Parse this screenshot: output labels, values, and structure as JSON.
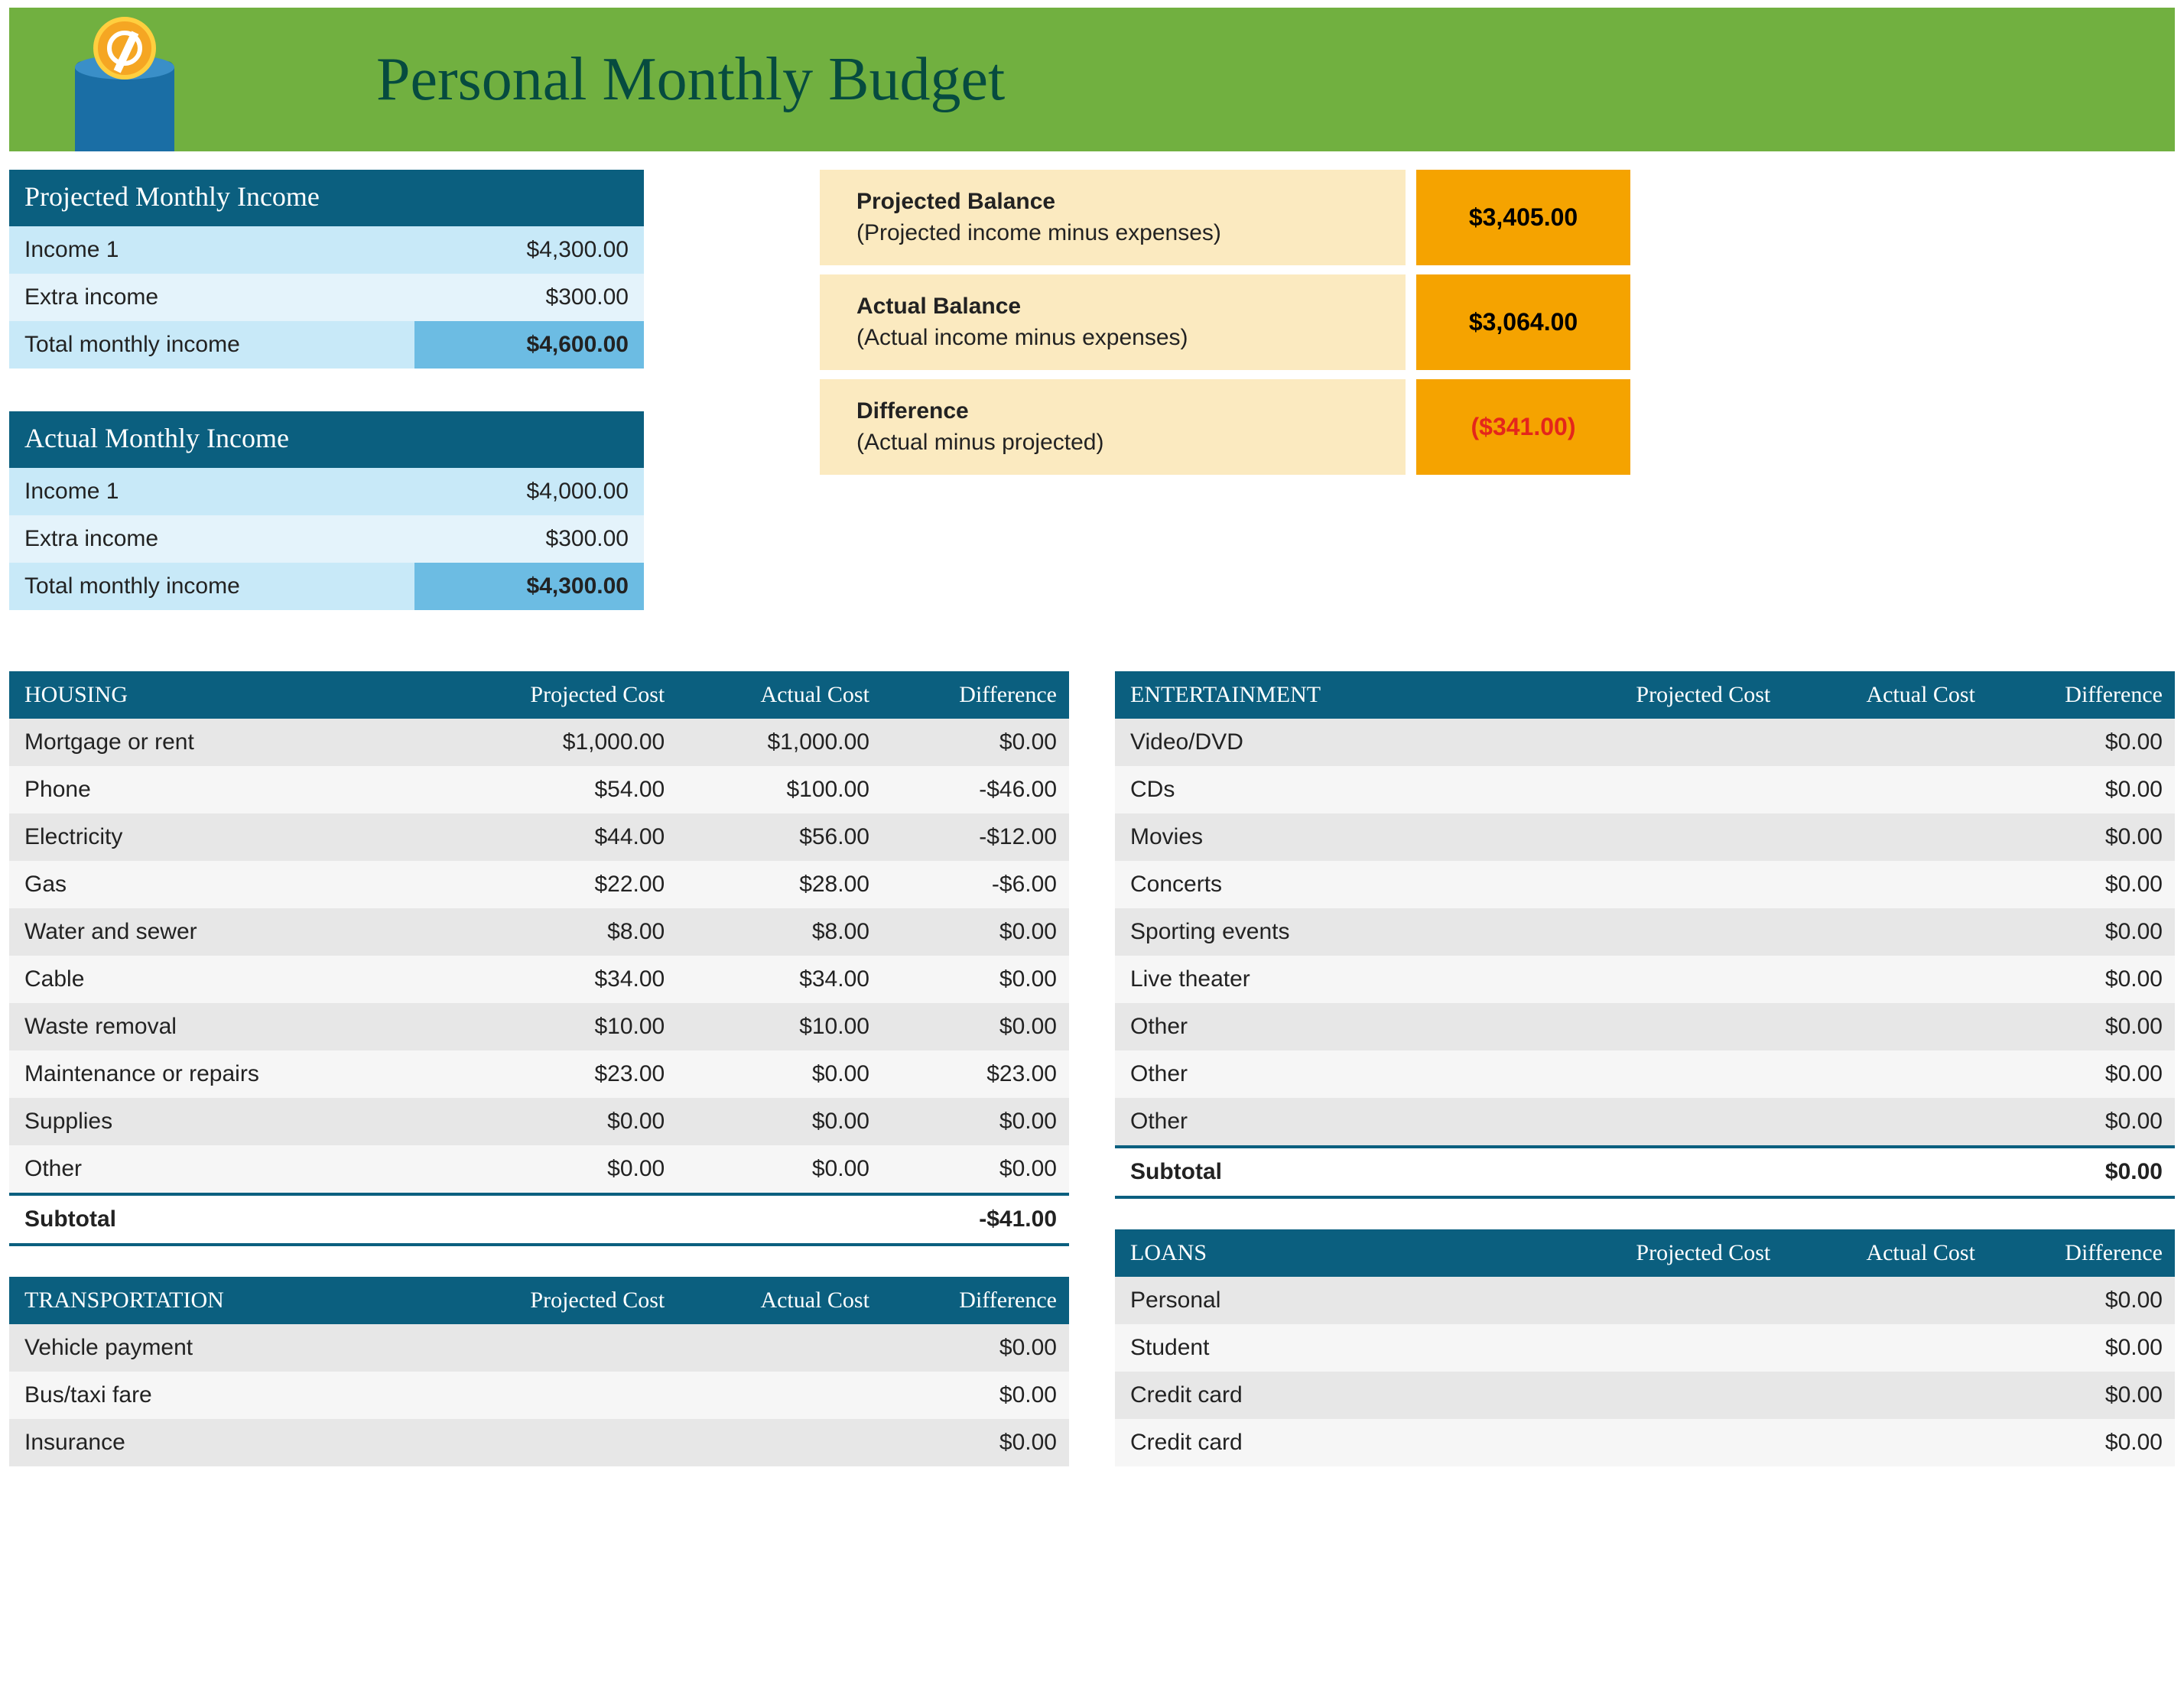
{
  "title": "Personal Monthly Budget",
  "projected_income": {
    "header": "Projected Monthly Income",
    "rows": [
      {
        "label": "Income 1",
        "value": "$4,300.00"
      },
      {
        "label": "Extra income",
        "value": "$300.00"
      }
    ],
    "total_label": "Total monthly income",
    "total_value": "$4,600.00"
  },
  "actual_income": {
    "header": "Actual Monthly Income",
    "rows": [
      {
        "label": "Income 1",
        "value": "$4,000.00"
      },
      {
        "label": "Extra income",
        "value": "$300.00"
      }
    ],
    "total_label": "Total monthly income",
    "total_value": "$4,300.00"
  },
  "balances": [
    {
      "label": "Projected Balance",
      "sub": "(Projected income minus expenses)",
      "value": "$3,405.00",
      "neg": false
    },
    {
      "label": "Actual Balance",
      "sub": "(Actual income minus expenses)",
      "value": "$3,064.00",
      "neg": false
    },
    {
      "label": "Difference",
      "sub": "(Actual minus projected)",
      "value": "($341.00)",
      "neg": true
    }
  ],
  "col_headers": {
    "projected": "Projected Cost",
    "actual": "Actual Cost",
    "difference": "Difference"
  },
  "subtotal_label": "Subtotal",
  "left_categories": [
    {
      "name": "HOUSING",
      "rows": [
        {
          "label": "Mortgage or rent",
          "projected": "$1,000.00",
          "actual": "$1,000.00",
          "difference": "$0.00"
        },
        {
          "label": "Phone",
          "projected": "$54.00",
          "actual": "$100.00",
          "difference": "-$46.00"
        },
        {
          "label": "Electricity",
          "projected": "$44.00",
          "actual": "$56.00",
          "difference": "-$12.00"
        },
        {
          "label": "Gas",
          "projected": "$22.00",
          "actual": "$28.00",
          "difference": "-$6.00"
        },
        {
          "label": "Water and sewer",
          "projected": "$8.00",
          "actual": "$8.00",
          "difference": "$0.00"
        },
        {
          "label": "Cable",
          "projected": "$34.00",
          "actual": "$34.00",
          "difference": "$0.00"
        },
        {
          "label": "Waste removal",
          "projected": "$10.00",
          "actual": "$10.00",
          "difference": "$0.00"
        },
        {
          "label": "Maintenance or repairs",
          "projected": "$23.00",
          "actual": "$0.00",
          "difference": "$23.00"
        },
        {
          "label": "Supplies",
          "projected": "$0.00",
          "actual": "$0.00",
          "difference": "$0.00"
        },
        {
          "label": "Other",
          "projected": "$0.00",
          "actual": "$0.00",
          "difference": "$0.00"
        }
      ],
      "subtotal_difference": "-$41.00"
    },
    {
      "name": "TRANSPORTATION",
      "rows": [
        {
          "label": "Vehicle payment",
          "projected": "",
          "actual": "",
          "difference": "$0.00"
        },
        {
          "label": "Bus/taxi fare",
          "projected": "",
          "actual": "",
          "difference": "$0.00"
        },
        {
          "label": "Insurance",
          "projected": "",
          "actual": "",
          "difference": "$0.00"
        }
      ],
      "subtotal_difference": null
    }
  ],
  "right_categories": [
    {
      "name": "ENTERTAINMENT",
      "rows": [
        {
          "label": "Video/DVD",
          "projected": "",
          "actual": "",
          "difference": "$0.00"
        },
        {
          "label": "CDs",
          "projected": "",
          "actual": "",
          "difference": "$0.00"
        },
        {
          "label": "Movies",
          "projected": "",
          "actual": "",
          "difference": "$0.00"
        },
        {
          "label": "Concerts",
          "projected": "",
          "actual": "",
          "difference": "$0.00"
        },
        {
          "label": "Sporting events",
          "projected": "",
          "actual": "",
          "difference": "$0.00"
        },
        {
          "label": "Live theater",
          "projected": "",
          "actual": "",
          "difference": "$0.00"
        },
        {
          "label": "Other",
          "projected": "",
          "actual": "",
          "difference": "$0.00"
        },
        {
          "label": "Other",
          "projected": "",
          "actual": "",
          "difference": "$0.00"
        },
        {
          "label": "Other",
          "projected": "",
          "actual": "",
          "difference": "$0.00"
        }
      ],
      "subtotal_difference": "$0.00"
    },
    {
      "name": "LOANS",
      "rows": [
        {
          "label": "Personal",
          "projected": "",
          "actual": "",
          "difference": "$0.00"
        },
        {
          "label": "Student",
          "projected": "",
          "actual": "",
          "difference": "$0.00"
        },
        {
          "label": "Credit card",
          "projected": "",
          "actual": "",
          "difference": "$0.00"
        },
        {
          "label": "Credit card",
          "projected": "",
          "actual": "",
          "difference": "$0.00"
        }
      ],
      "subtotal_difference": null
    }
  ]
}
